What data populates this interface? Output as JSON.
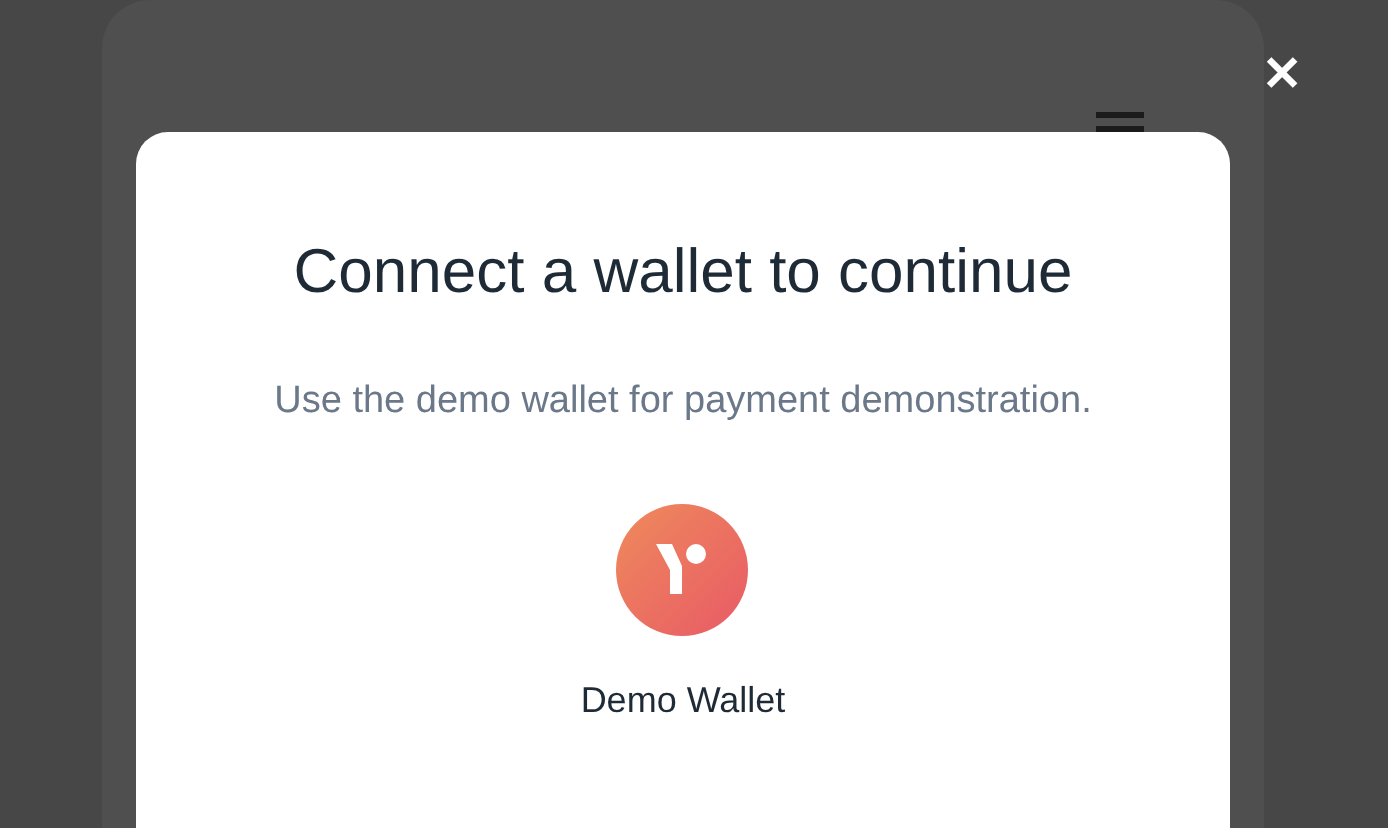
{
  "close_button": {
    "label": "✕"
  },
  "modal": {
    "title": "Connect a wallet to continue",
    "subtitle": "Use the demo wallet for payment demonstration.",
    "wallets": [
      {
        "name": "Demo Wallet"
      }
    ]
  }
}
